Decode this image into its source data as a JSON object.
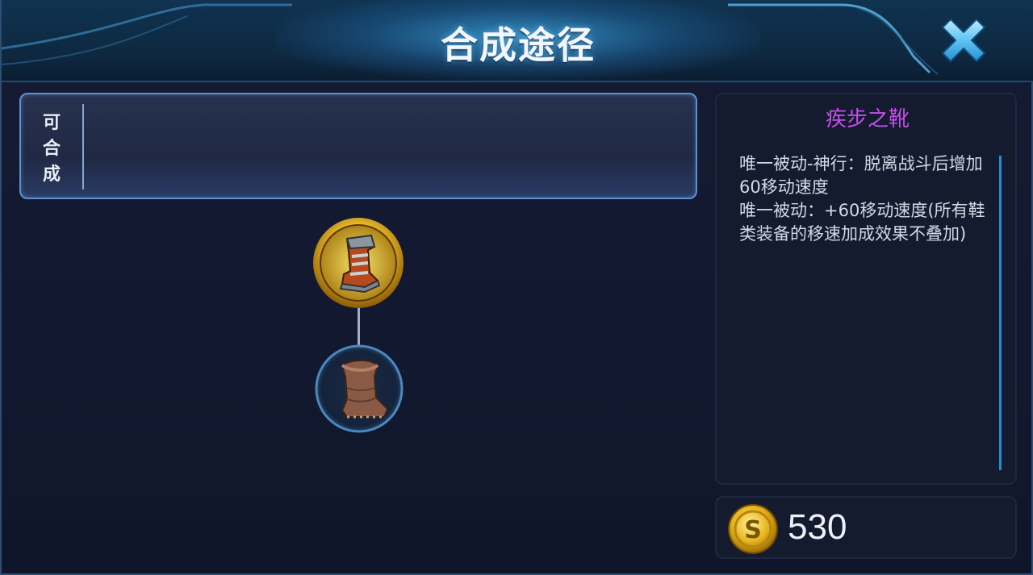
{
  "header": {
    "title": "合成途径"
  },
  "recipe": {
    "label_chars": [
      "可",
      "合",
      "成"
    ]
  },
  "tree": {
    "main_item": {
      "icon": "swift-boots-icon"
    },
    "sub_item": {
      "icon": "basic-boots-icon"
    }
  },
  "info": {
    "name": "疾步之靴",
    "desc": [
      "唯一被动-神行：脱离战斗后增加60移动速度",
      "唯一被动：+60移动速度(所有鞋类装备的移速加成效果不叠加)"
    ],
    "name_color": "#c44ee8"
  },
  "price": {
    "value": "530",
    "icon": "gold-coin-icon"
  },
  "colors": {
    "accent": "#1d8fd0",
    "frame": "#5f8fd0"
  }
}
